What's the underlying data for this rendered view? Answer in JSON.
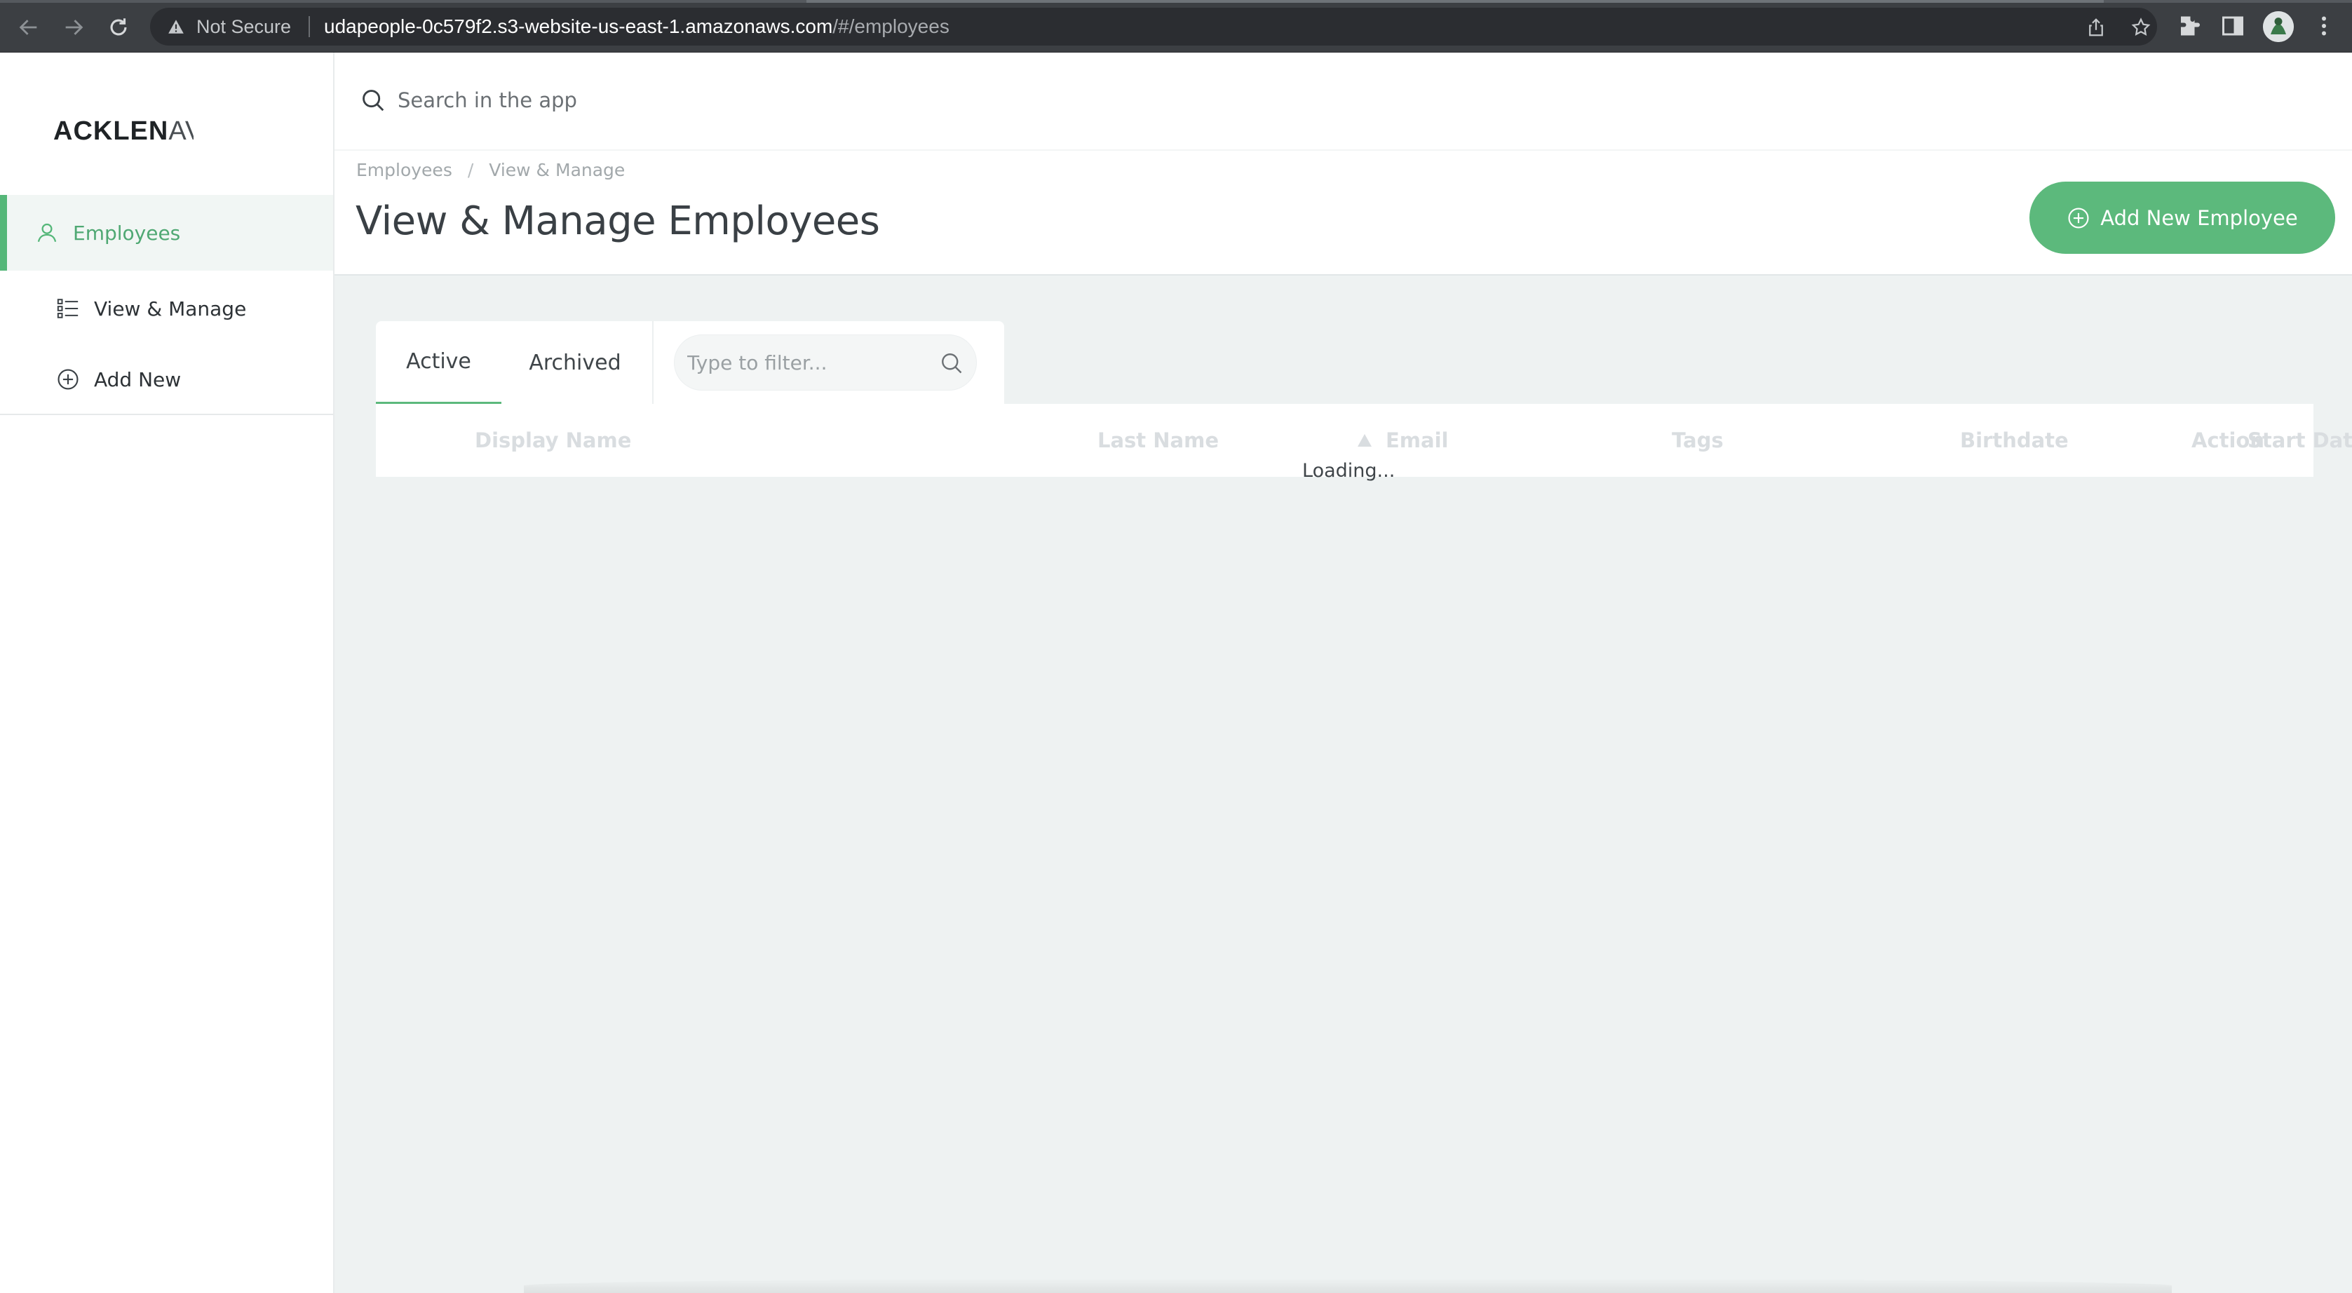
{
  "browser": {
    "security_label": "Not Secure",
    "url_host": "udapeople-0c579f2.s3-website-us-east-1.amazonaws.com",
    "url_path": "/#/employees"
  },
  "sidebar": {
    "logo_bold": "ACKLEN",
    "logo_light": "AV",
    "items": [
      {
        "label": "Employees",
        "icon": "person-icon",
        "active": true
      },
      {
        "label": "View & Manage",
        "icon": "list-icon",
        "active": false
      },
      {
        "label": "Add New",
        "icon": "plus-circle-icon",
        "active": false
      }
    ]
  },
  "header": {
    "search_placeholder": "Search in the app",
    "breadcrumb": [
      "Employees",
      "View & Manage"
    ],
    "breadcrumb_separator": "/",
    "title": "View & Manage Employees",
    "add_button_label": "Add New Employee"
  },
  "table": {
    "tabs": [
      "Active",
      "Archived"
    ],
    "filter_placeholder": "Type to filter...",
    "columns": [
      "Display Name",
      "Last Name",
      "Email",
      "Tags",
      "Birthdate",
      "Start Date",
      "Action"
    ],
    "loading_text": "Loading..."
  },
  "colors": {
    "accent": "#5cb97c",
    "chrome_bg": "#3c3f43",
    "content_bg": "#eef2f2"
  }
}
